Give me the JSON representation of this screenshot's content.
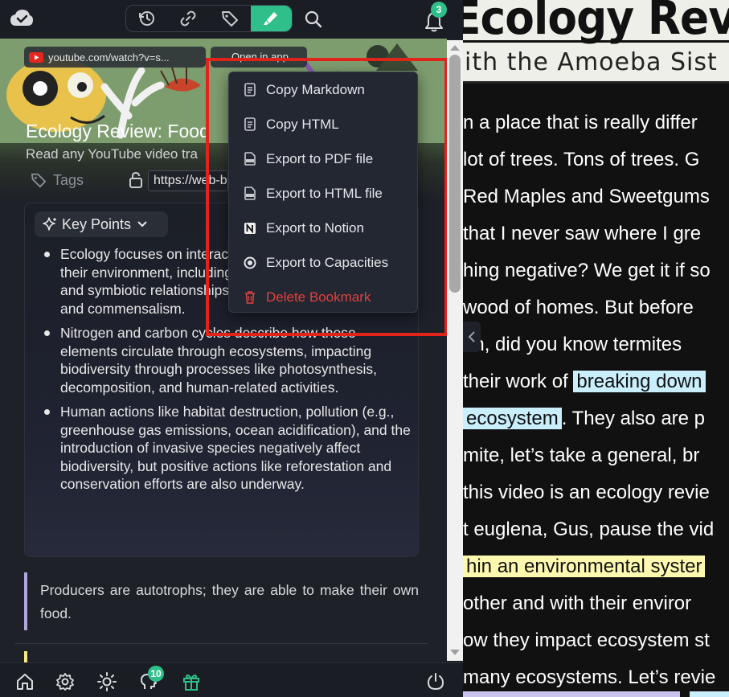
{
  "toolbar": {
    "notification_count": "3"
  },
  "header": {
    "url_chip": "youtube.com/watch?v=s...",
    "open_in_app": "Open in app",
    "title": "Ecology Review: Food",
    "description": "Read any YouTube video tra",
    "tags_label": "Tags",
    "url_value": "https://web-b"
  },
  "key_points": {
    "title": "Key Points",
    "items": [
      "Ecology focuses on interactions among organisms and their environment, including predator-prey relationships, and symbiotic relationships like parasitism, mutualism, and commensalism.",
      "Nitrogen and carbon cycles describe how these elements circulate through ecosystems, impacting biodiversity through processes like photosynthesis, decomposition, and human-related activities.",
      "Human actions like habitat destruction, pollution (e.g., greenhouse gas emissions, ocean acidification), and the introduction of invasive species negatively affect biodiversity, but positive actions like reforestation and conservation efforts are also underway."
    ]
  },
  "quote": {
    "text": "Producers are autotrophs;   they are able to make their own food."
  },
  "menu": {
    "items": [
      {
        "label": "Copy Markdown",
        "icon": "markdown-file-icon"
      },
      {
        "label": "Copy HTML",
        "icon": "html-file-icon"
      },
      {
        "label": "Export to PDF file",
        "icon": "pdf-file-icon"
      },
      {
        "label": "Export to HTML file",
        "icon": "html-export-icon"
      },
      {
        "label": "Export to Notion",
        "icon": "notion-icon"
      },
      {
        "label": "Export to Capacities",
        "icon": "capacities-icon"
      },
      {
        "label": "Delete Bookmark",
        "icon": "trash-icon"
      }
    ],
    "danger_color": "#e0413f"
  },
  "bottom_bar": {
    "apps_badge": "10"
  },
  "video": {
    "title_banner": "Ecology Review",
    "subtitle_banner": "ith the Amoeba Sist",
    "transcript": [
      "n a place that is really  differ",
      " lot of trees. Tons of  trees. G",
      "Red Maples and  Sweetgums",
      " that I never saw  where I gre",
      "hing negative? We get  it if so",
      " wood of homes.  But before",
      "on, did  you know termites",
      "their work of ",
      " ecosystem",
      "mite, let’s  take a general, br",
      "this video is an  ecology revie",
      "t euglena,  Gus, pause the vid",
      "hin  an environmental syster",
      " other and with their enviror",
      "ow they impact ecosystem st",
      "many ecosystems. Let’s revie"
    ],
    "highlight_1": "breaking down",
    "line_9_rest": ".  They also are p"
  },
  "colors": {
    "accent": "#2fbf8a",
    "annotation_red": "#e2231a",
    "highlight_blue": "#c9eefc",
    "highlight_yellow": "#fff9b0"
  }
}
